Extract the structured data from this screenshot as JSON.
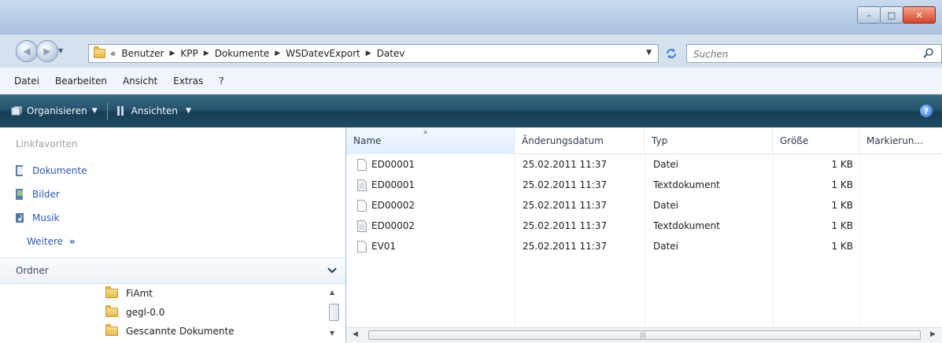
{
  "window": {
    "controls": {
      "minimize": "–",
      "maximize": "□",
      "close": "✕"
    }
  },
  "nav": {
    "back_glyph": "◀",
    "forward_glyph": "▶",
    "history_glyph": "▼"
  },
  "address": {
    "overflow": "«",
    "separator": "▶",
    "crumbs": [
      "Benutzer",
      "KPP",
      "Dokumente",
      "WSDatevExport",
      "Datev"
    ],
    "dropdown_glyph": "▼"
  },
  "refresh_glyph": "⁴⁺",
  "search": {
    "placeholder": "Suchen"
  },
  "menu": [
    "Datei",
    "Bearbeiten",
    "Ansicht",
    "Extras",
    "?"
  ],
  "toolbar": {
    "organize_label": "Organisieren",
    "views_label": "Ansichten",
    "caret": "▼",
    "help": "?"
  },
  "nav_pane": {
    "favorites_heading": "Linkfavoriten",
    "favorites": [
      "Dokumente",
      "Bilder",
      "Musik"
    ],
    "more_label": "Weitere",
    "more_glyph": "»",
    "folders_heading": "Ordner",
    "tree": [
      "FiAmt",
      "gegl-0.0",
      "Gescannte Dokumente"
    ],
    "scroll_up": "▲",
    "scroll_down": "▼"
  },
  "file_list": {
    "columns": [
      "Name",
      "Änderungsdatum",
      "Typ",
      "Größe",
      "Markierun..."
    ],
    "sort_glyph": "▲",
    "rows": [
      {
        "name": "ED00001",
        "date": "25.02.2011 11:37",
        "type": "Datei",
        "size": "1 KB"
      },
      {
        "name": "ED00001",
        "date": "25.02.2011 11:37",
        "type": "Textdokument",
        "size": "1 KB"
      },
      {
        "name": "ED00002",
        "date": "25.02.2011 11:37",
        "type": "Datei",
        "size": "1 KB"
      },
      {
        "name": "ED00002",
        "date": "25.02.2011 11:37",
        "type": "Textdokument",
        "size": "1 KB"
      },
      {
        "name": "EV01",
        "date": "25.02.2011 11:37",
        "type": "Datei",
        "size": "1 KB"
      }
    ],
    "scroll_left": "◀",
    "scroll_right": "▶",
    "scroll_grip": "|||"
  },
  "colors": {
    "toolbar": "#1c4c64",
    "link": "#2b5bb8",
    "folder": "#e7b94c"
  }
}
